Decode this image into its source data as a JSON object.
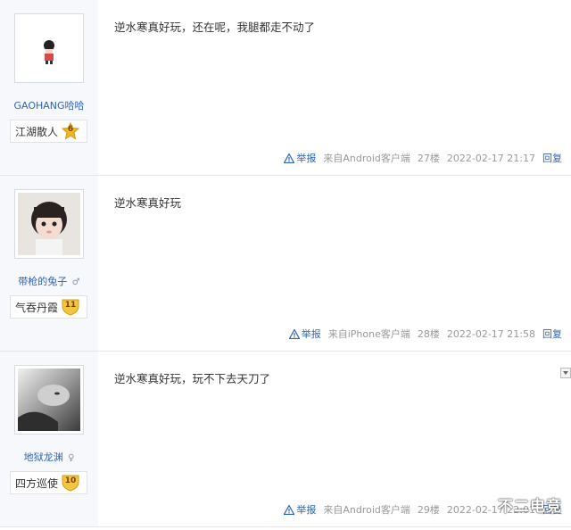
{
  "posts": [
    {
      "username": "GAOHANG哈哈",
      "gender": "",
      "badge_title": "江湖散人",
      "level": "6",
      "text": "逆水寒真好玩，还在呢，我腿都走不动了",
      "report_label": "举报",
      "source": "来自Android客户端",
      "floor": "27楼",
      "timestamp": "2022-02-17 21:17",
      "reply_label": "回复"
    },
    {
      "username": "带枪的兔子",
      "gender": "♂",
      "badge_title": "气吞丹霞",
      "level": "11",
      "text": "逆水寒真好玩",
      "report_label": "举报",
      "source": "来自iPhone客户端",
      "floor": "28楼",
      "timestamp": "2022-02-17 21:58",
      "reply_label": "回复"
    },
    {
      "username": "地狱龙渊",
      "gender": "♀",
      "badge_title": "四方巡使",
      "level": "10",
      "text": "逆水寒真好玩，玩不下去天刀了",
      "report_label": "举报",
      "source": "来自Android客户端",
      "floor": "29楼",
      "timestamp": "2022-02-17 22:01",
      "reply_label": "回复"
    }
  ],
  "watermark": "不二电竞",
  "icons": {
    "report": "warning-triangle-icon",
    "level": "shield-level-icon",
    "menu": "dropdown-arrow-icon"
  },
  "colors": {
    "link": "#2d64b3",
    "sidebar": "#f6f8fb",
    "meta": "#999999",
    "level_gold": "#f2b61f"
  }
}
